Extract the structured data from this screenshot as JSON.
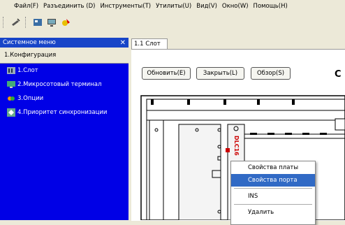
{
  "menubar": [
    "Файл(F)",
    "Разъединить (D)",
    "Инструменты(T)",
    "Утилиты(U)",
    "Вид(V)",
    "Окно(W)",
    "Помощь(H)"
  ],
  "toolbar": {
    "icons": [
      "connect-icon",
      "card-icon",
      "monitor-icon",
      "alarm-icon"
    ]
  },
  "sidebar": {
    "header": "Системное меню",
    "close_glyph": "✕",
    "title": "1.Конфигурация",
    "items": [
      {
        "label": "1.Слот",
        "icon": "slot-icon"
      },
      {
        "label": "2.Микросотовый терминал",
        "icon": "terminal-icon"
      },
      {
        "label": "3.Опции",
        "icon": "options-icon"
      },
      {
        "label": "4.Приоритет синхронизации",
        "icon": "sync-icon"
      }
    ]
  },
  "tab": {
    "label": "1.1 Слот"
  },
  "buttons": {
    "refresh": "Обновить(E)",
    "close": "Закрыть(L)",
    "browse": "Обзор(S)"
  },
  "header_partial": "С",
  "card_label": "DLC16",
  "context_menu": {
    "items": [
      "Свойства платы",
      "Свойства порта",
      "INS",
      "Удалить"
    ],
    "selected_index": 1
  },
  "colors": {
    "sidebar_bg": "#0000e6",
    "sidebar_header_bg": "#1845c8",
    "selection": "#316ac5",
    "card_label_color": "#cc0000"
  }
}
